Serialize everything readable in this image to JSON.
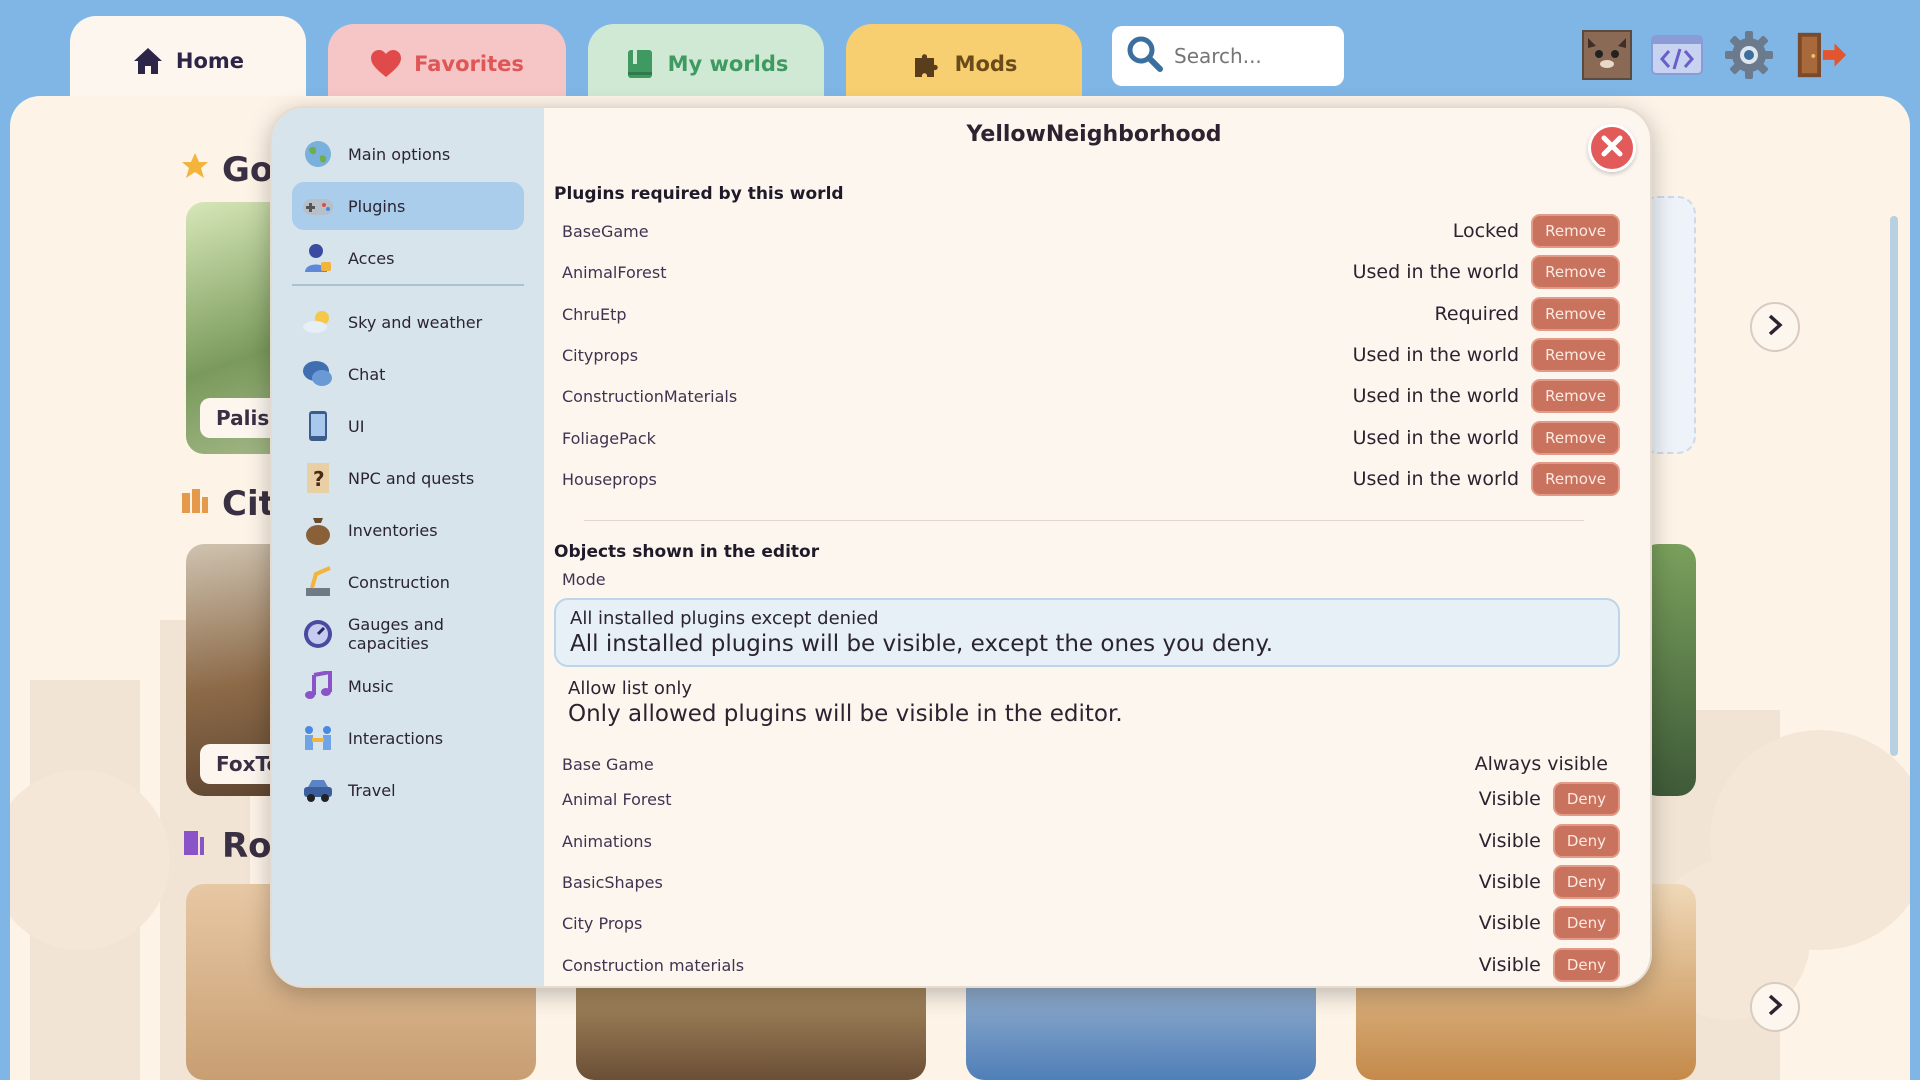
{
  "tabs": [
    {
      "label": "Home",
      "icon": "home-icon"
    },
    {
      "label": "Favorites",
      "icon": "heart-icon"
    },
    {
      "label": "My worlds",
      "icon": "book-icon"
    },
    {
      "label": "Mods",
      "icon": "puzzle-icon"
    }
  ],
  "search": {
    "placeholder": "Search..."
  },
  "background": {
    "sections": [
      {
        "title": "Go",
        "icon": "star-icon"
      },
      {
        "title": "Cit",
        "icon": "city-icon"
      },
      {
        "title": "Ro",
        "icon": "door-icon"
      }
    ],
    "cards": [
      "Palis",
      "FoxTo"
    ]
  },
  "modal": {
    "title": "YellowNeighborhood",
    "nav": [
      {
        "label": "Main options",
        "icon": "globe-icon"
      },
      {
        "label": "Plugins",
        "icon": "gamepad-icon"
      },
      {
        "label": "Acces",
        "icon": "user-lock-icon"
      },
      {
        "label": "Sky and weather",
        "icon": "weather-icon"
      },
      {
        "label": "Chat",
        "icon": "chat-icon"
      },
      {
        "label": "UI",
        "icon": "phone-icon"
      },
      {
        "label": "NPC and quests",
        "icon": "quest-icon"
      },
      {
        "label": "Inventories",
        "icon": "bag-icon"
      },
      {
        "label": "Construction",
        "icon": "crane-icon"
      },
      {
        "label": "Gauges and capacities",
        "icon": "gauge-icon"
      },
      {
        "label": "Music",
        "icon": "music-icon"
      },
      {
        "label": "Interactions",
        "icon": "interaction-icon"
      },
      {
        "label": "Travel",
        "icon": "car-icon"
      }
    ],
    "required_heading": "Plugins required by this world",
    "required": [
      {
        "name": "BaseGame",
        "status": "Locked",
        "action": "Remove"
      },
      {
        "name": "AnimalForest",
        "status": "Used in the world",
        "action": "Remove"
      },
      {
        "name": "ChruEtp",
        "status": "Required",
        "action": "Remove"
      },
      {
        "name": "Cityprops",
        "status": "Used in the world",
        "action": "Remove"
      },
      {
        "name": "ConstructionMaterials",
        "status": "Used in the world",
        "action": "Remove"
      },
      {
        "name": "FoliagePack",
        "status": "Used in the world",
        "action": "Remove"
      },
      {
        "name": "Houseprops",
        "status": "Used in the world",
        "action": "Remove"
      }
    ],
    "objects_heading": "Objects shown in the editor",
    "mode_label": "Mode",
    "modes": [
      {
        "title": "All installed plugins except denied",
        "desc": "All installed plugins will be visible, except the ones you deny.",
        "selected": true
      },
      {
        "title": "Allow list only",
        "desc": "Only allowed plugins will be visible in the editor.",
        "selected": false
      }
    ],
    "visibility": [
      {
        "name": "Base Game",
        "status": "Always visible",
        "action": ""
      },
      {
        "name": "Animal Forest",
        "status": "Visible",
        "action": "Deny"
      },
      {
        "name": "Animations",
        "status": "Visible",
        "action": "Deny"
      },
      {
        "name": "BasicShapes",
        "status": "Visible",
        "action": "Deny"
      },
      {
        "name": "City Props",
        "status": "Visible",
        "action": "Deny"
      },
      {
        "name": "Construction materials",
        "status": "Visible",
        "action": "Deny"
      }
    ]
  },
  "colors": {
    "accent": "#a9cdeb",
    "danger": "#e25a5a",
    "button": "#c9735e",
    "background": "#fdf3e7"
  }
}
